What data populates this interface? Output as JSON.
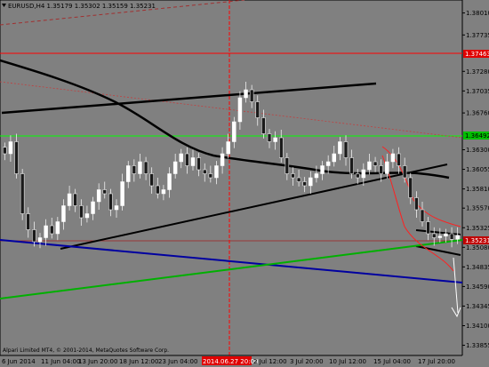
{
  "window": {
    "symbol_line": "EURUSD,H4  1.35179 1.35302 1.35159 1.35231",
    "copyright": "Alpari Limited MT4, © 2001-2014, MetaQuotes Software Corp."
  },
  "colors": {
    "background": "#808080",
    "candle_up": "#2b2b2b",
    "candle_down": "#2b2b2b",
    "marker_red": "#ff0000",
    "marker_green": "#00ff00",
    "trend_black": "#000000",
    "trend_blue": "#0000a0",
    "trend_green": "#00b000",
    "envelope_red": "#ff2020"
  },
  "price_axis": {
    "ticks": [
      "1.38010",
      "1.37735",
      "1.37463",
      "1.37280",
      "1.37035",
      "1.36760",
      "1.36492",
      "1.36300",
      "1.36055",
      "1.35810",
      "1.35570",
      "1.35325",
      "1.35231",
      "1.35080",
      "1.34835",
      "1.34590",
      "1.34345",
      "1.34100",
      "1.33855"
    ],
    "current_price": "1.35231",
    "green_level": "1.36492",
    "red_level": "1.37463"
  },
  "time_axis": {
    "labels": [
      "6 Jun 2014",
      "11 Jun 04:00",
      "13 Jun 20:00",
      "18 Jun 12:00",
      "23 Jun 04:00",
      "2014.06.27 20:00",
      "2 Jul 12:00",
      "3 Jul 20:00",
      "10 Jul 12:00",
      "15 Jul 04:00",
      "17 Jul 20:00"
    ],
    "highlighted": "2014.06.27 20:00"
  },
  "chart_data": {
    "type": "candlestick",
    "symbol": "EURUSD",
    "timeframe": "H4",
    "ylim": [
      1.3375,
      1.3815
    ],
    "close_series": [
      1.3625,
      1.364,
      1.36,
      1.355,
      1.353,
      1.3515,
      1.352,
      1.3535,
      1.3525,
      1.354,
      1.356,
      1.3575,
      1.356,
      1.3545,
      1.355,
      1.3565,
      1.358,
      1.3575,
      1.3555,
      1.356,
      1.359,
      1.361,
      1.36,
      1.3615,
      1.36,
      1.3585,
      1.3575,
      1.358,
      1.36,
      1.3615,
      1.3625,
      1.361,
      1.362,
      1.3605,
      1.36,
      1.3595,
      1.361,
      1.3625,
      1.364,
      1.3665,
      1.3695,
      1.3705,
      1.369,
      1.367,
      1.365,
      1.364,
      1.3645,
      1.362,
      1.36,
      1.3595,
      1.359,
      1.3585,
      1.3595,
      1.36,
      1.361,
      1.3615,
      1.3625,
      1.364,
      1.362,
      1.36,
      1.3595,
      1.3605,
      1.3615,
      1.361,
      1.36,
      1.3615,
      1.3625,
      1.361,
      1.3595,
      1.357,
      1.3555,
      1.354,
      1.3525,
      1.352,
      1.3522,
      1.3525,
      1.3518,
      1.3523
    ]
  }
}
